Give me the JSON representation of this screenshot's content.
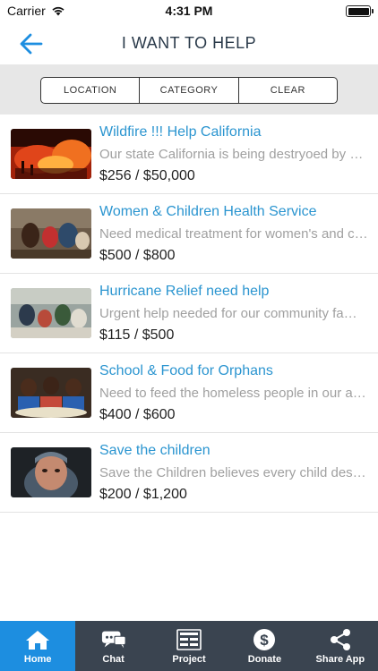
{
  "status_bar": {
    "carrier": "Carrier",
    "time": "4:31 PM"
  },
  "header": {
    "title": "I WANT TO HELP"
  },
  "filters": {
    "location": "LOCATION",
    "category": "CATEGORY",
    "clear": "CLEAR"
  },
  "campaigns": [
    {
      "title": "Wildfire !!! Help California",
      "description": "Our state California is being destryoed by wildfires",
      "amount": "$256 / $50,000"
    },
    {
      "title": "Women & Children Health Service",
      "description": "Need medical treatment for women's and children",
      "amount": "$500 / $800"
    },
    {
      "title": "Hurricane Relief need help",
      "description": "Urgent help needed for our community families",
      "amount": "$115 / $500"
    },
    {
      "title": "School & Food for Orphans",
      "description": "Need to feed the homeless people in our area",
      "amount": "$400 / $600"
    },
    {
      "title": "Save the children",
      "description": "Save the Children believes every child deserves",
      "amount": "$200 / $1,200"
    }
  ],
  "tabs": [
    {
      "label": "Home",
      "icon": "home-icon"
    },
    {
      "label": "Chat",
      "icon": "chat-icon"
    },
    {
      "label": "Project",
      "icon": "project-icon"
    },
    {
      "label": "Donate",
      "icon": "dollar-icon"
    },
    {
      "label": "Share App",
      "icon": "share-icon"
    }
  ],
  "colors": {
    "accent": "#1d8ee0",
    "title_blue": "#2b95d0",
    "tab_bar": "#3a4450",
    "filter_band": "#e7e7e7"
  }
}
